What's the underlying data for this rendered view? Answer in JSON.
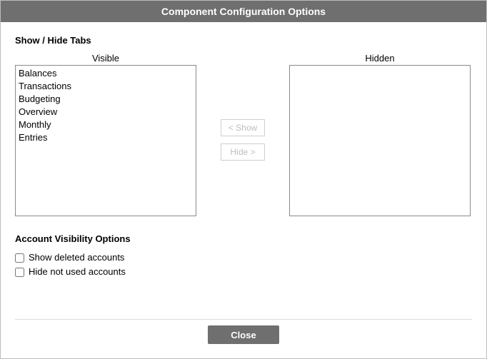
{
  "title": "Component Configuration Options",
  "tabs_section": {
    "title": "Show / Hide Tabs",
    "visible_label": "Visible",
    "hidden_label": "Hidden",
    "show_button": "< Show",
    "hide_button": "Hide >",
    "visible_items": [
      "Balances",
      "Transactions",
      "Budgeting",
      "Overview",
      "Monthly",
      "Entries"
    ],
    "hidden_items": []
  },
  "accounts_section": {
    "title": "Account Visibility Options",
    "show_deleted": {
      "label": "Show deleted accounts",
      "checked": false
    },
    "hide_unused": {
      "label": "Hide not used accounts",
      "checked": false
    }
  },
  "footer": {
    "close": "Close"
  }
}
